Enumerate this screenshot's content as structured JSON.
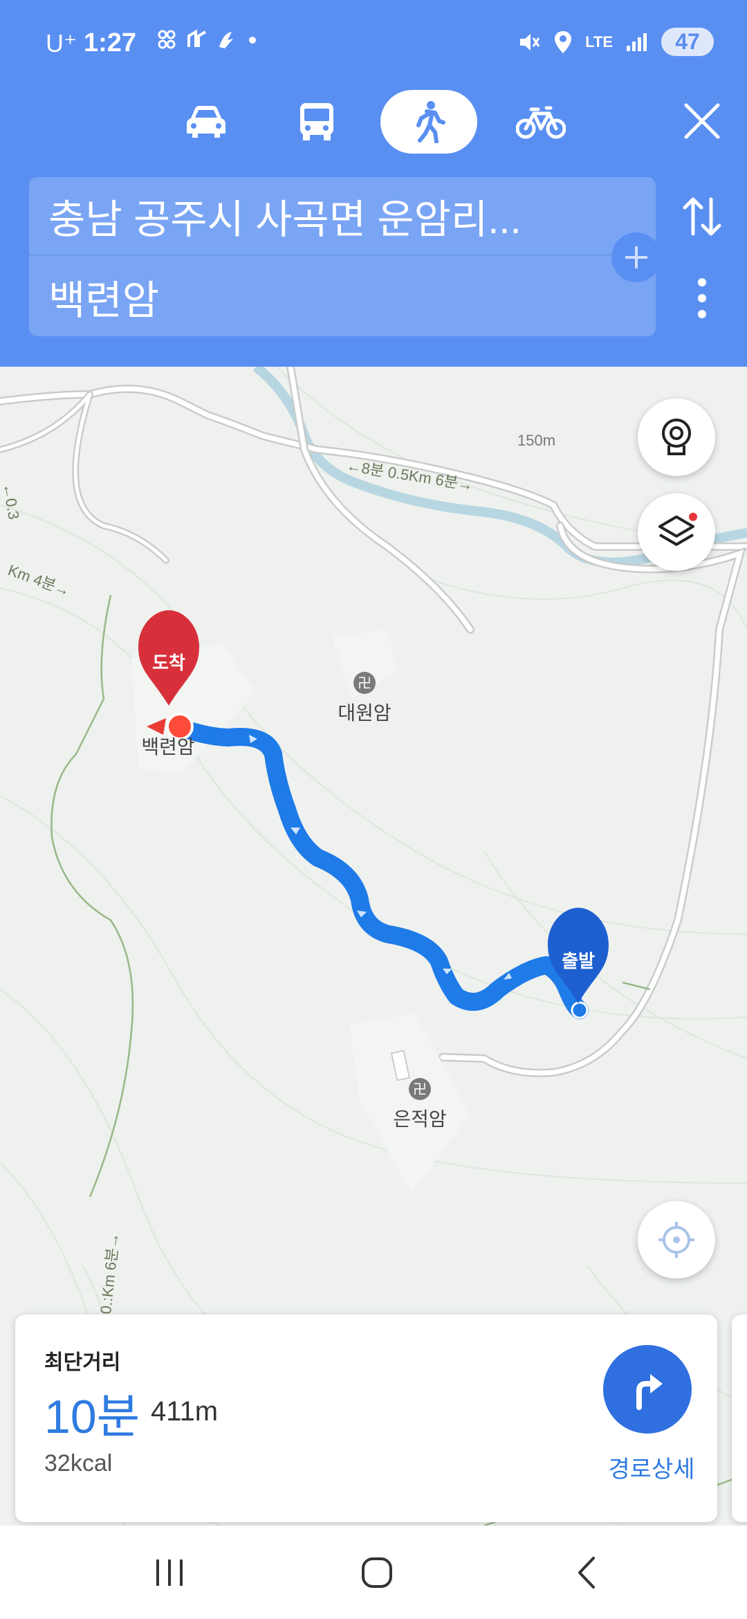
{
  "status_bar": {
    "carrier": "U⁺",
    "time": "1:27",
    "battery": "47",
    "network": "LTE"
  },
  "travel_modes": [
    {
      "name": "car",
      "icon": "car-icon",
      "active": false
    },
    {
      "name": "bus",
      "icon": "bus-icon",
      "active": false
    },
    {
      "name": "walk",
      "icon": "walk-icon",
      "active": true
    },
    {
      "name": "bike",
      "icon": "bike-icon",
      "active": false
    }
  ],
  "route": {
    "origin": "충남 공주시 사곡면 운암리...",
    "destination": "백련암"
  },
  "map": {
    "contour_label": "150m",
    "trail_labels": {
      "top": "←8분 0.5Km 6분→",
      "left": "Km 4분→",
      "left_side": "←0.3",
      "bottom": "0.:Km 6분→"
    },
    "pois": [
      {
        "name": "대원암",
        "icon": "temple-icon"
      },
      {
        "name": "백련암",
        "icon": "temple-icon"
      },
      {
        "name": "은적암",
        "icon": "temple-icon"
      }
    ],
    "pins": {
      "arrival": "도착",
      "departure": "출발"
    },
    "colors": {
      "route": "#1e7be8",
      "arrival_pin": "#d8303a",
      "departure_pin": "#1e5fd0",
      "header": "#5a8ff2"
    }
  },
  "summary": {
    "type": "최단거리",
    "time": "10분",
    "distance": "411m",
    "kcal": "32kcal",
    "detail_label": "경로상세"
  }
}
